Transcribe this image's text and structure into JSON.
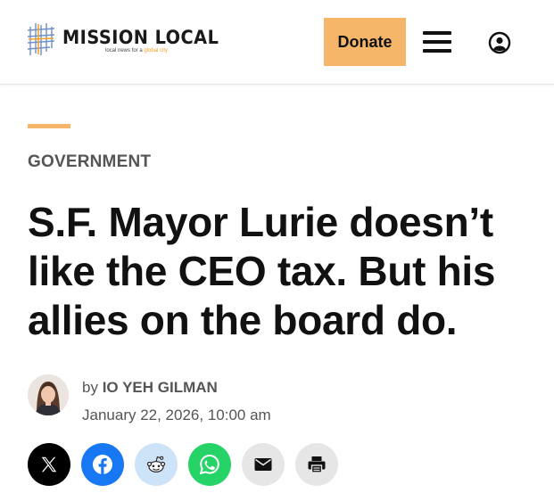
{
  "header": {
    "logo_name": "MISSION LOCAL",
    "logo_tagline_prefix": "local news for a ",
    "logo_tagline_highlight": "global city",
    "donate_label": "Donate",
    "menu_icon": "hamburger-menu-icon",
    "user_icon": "user-account-icon"
  },
  "article": {
    "category": "GOVERNMENT",
    "headline": "S.F. Mayor Lurie doesn’t like the CEO tax. But his allies on the board do.",
    "byline_prefix": "by",
    "author": "IO YEH GILMAN",
    "date": "January 22, 2026, 10:00 am"
  },
  "share": {
    "buttons": [
      {
        "network": "X",
        "icon": "x-icon",
        "color": "#000000"
      },
      {
        "network": "Facebook",
        "icon": "facebook-icon",
        "color": "#1877f2"
      },
      {
        "network": "Reddit",
        "icon": "reddit-icon",
        "color": "#cde3f7"
      },
      {
        "network": "WhatsApp",
        "icon": "whatsapp-icon",
        "color": "#25d366"
      },
      {
        "network": "Email",
        "icon": "email-icon",
        "color": "#e6e6e6"
      },
      {
        "network": "Print",
        "icon": "print-icon",
        "color": "#e6e6e6"
      }
    ]
  },
  "colors": {
    "accent": "#f6b66a",
    "text": "#111111",
    "muted": "#555555"
  }
}
